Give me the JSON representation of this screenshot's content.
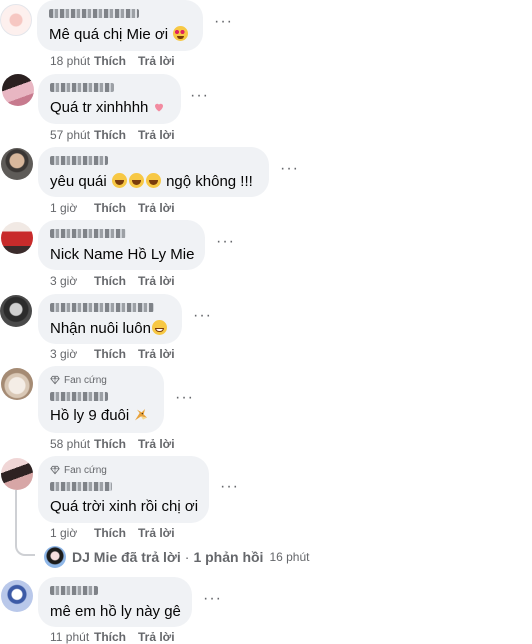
{
  "comments": [
    {
      "text": "Mê quá chị Mie ơi",
      "emoji": "love-eyes",
      "time": "18 phút",
      "like": "Thích",
      "reply": "Trả lời",
      "more": "···"
    },
    {
      "text": "Quá tr xinhhhh",
      "emoji": "heart",
      "time": "57 phút",
      "like": "Thích",
      "reply": "Trả lời",
      "more": "···"
    },
    {
      "text": "yêu quái",
      "text_after": "ngộ không !!!",
      "emoji": "laugh x3",
      "time": "1 giờ",
      "like": "Thích",
      "reply": "Trả lời",
      "more": "···"
    },
    {
      "text": "Nick Name Hồ Ly Mie",
      "time": "3 giờ",
      "like": "Thích",
      "reply": "Trả lời",
      "more": "···"
    },
    {
      "text": "Nhận nuôi luôn",
      "emoji": "grin",
      "time": "3 giờ",
      "like": "Thích",
      "reply": "Trả lời",
      "more": "···"
    },
    {
      "badge": "Fan cứng",
      "text": "Hồ ly 9 đuôi",
      "emoji": "fox",
      "time": "58 phút",
      "like": "Thích",
      "reply": "Trả lời",
      "more": "···"
    },
    {
      "badge": "Fan cứng",
      "text": "Quá trời xinh rồi chị ơi",
      "time": "1 giờ",
      "like": "Thích",
      "reply": "Trả lời",
      "more": "···"
    },
    {
      "text": "mê em hồ ly này gê",
      "time": "11 phút",
      "like": "Thích",
      "reply": "Trả lời",
      "more": "···"
    }
  ],
  "replies": {
    "author": "DJ Mie đã trả lời",
    "separator": "·",
    "count": "1 phản hồi",
    "age": "16 phút"
  },
  "colors": {
    "bubble": "#f0f2f5",
    "meta": "#65676b",
    "text": "#050505"
  }
}
